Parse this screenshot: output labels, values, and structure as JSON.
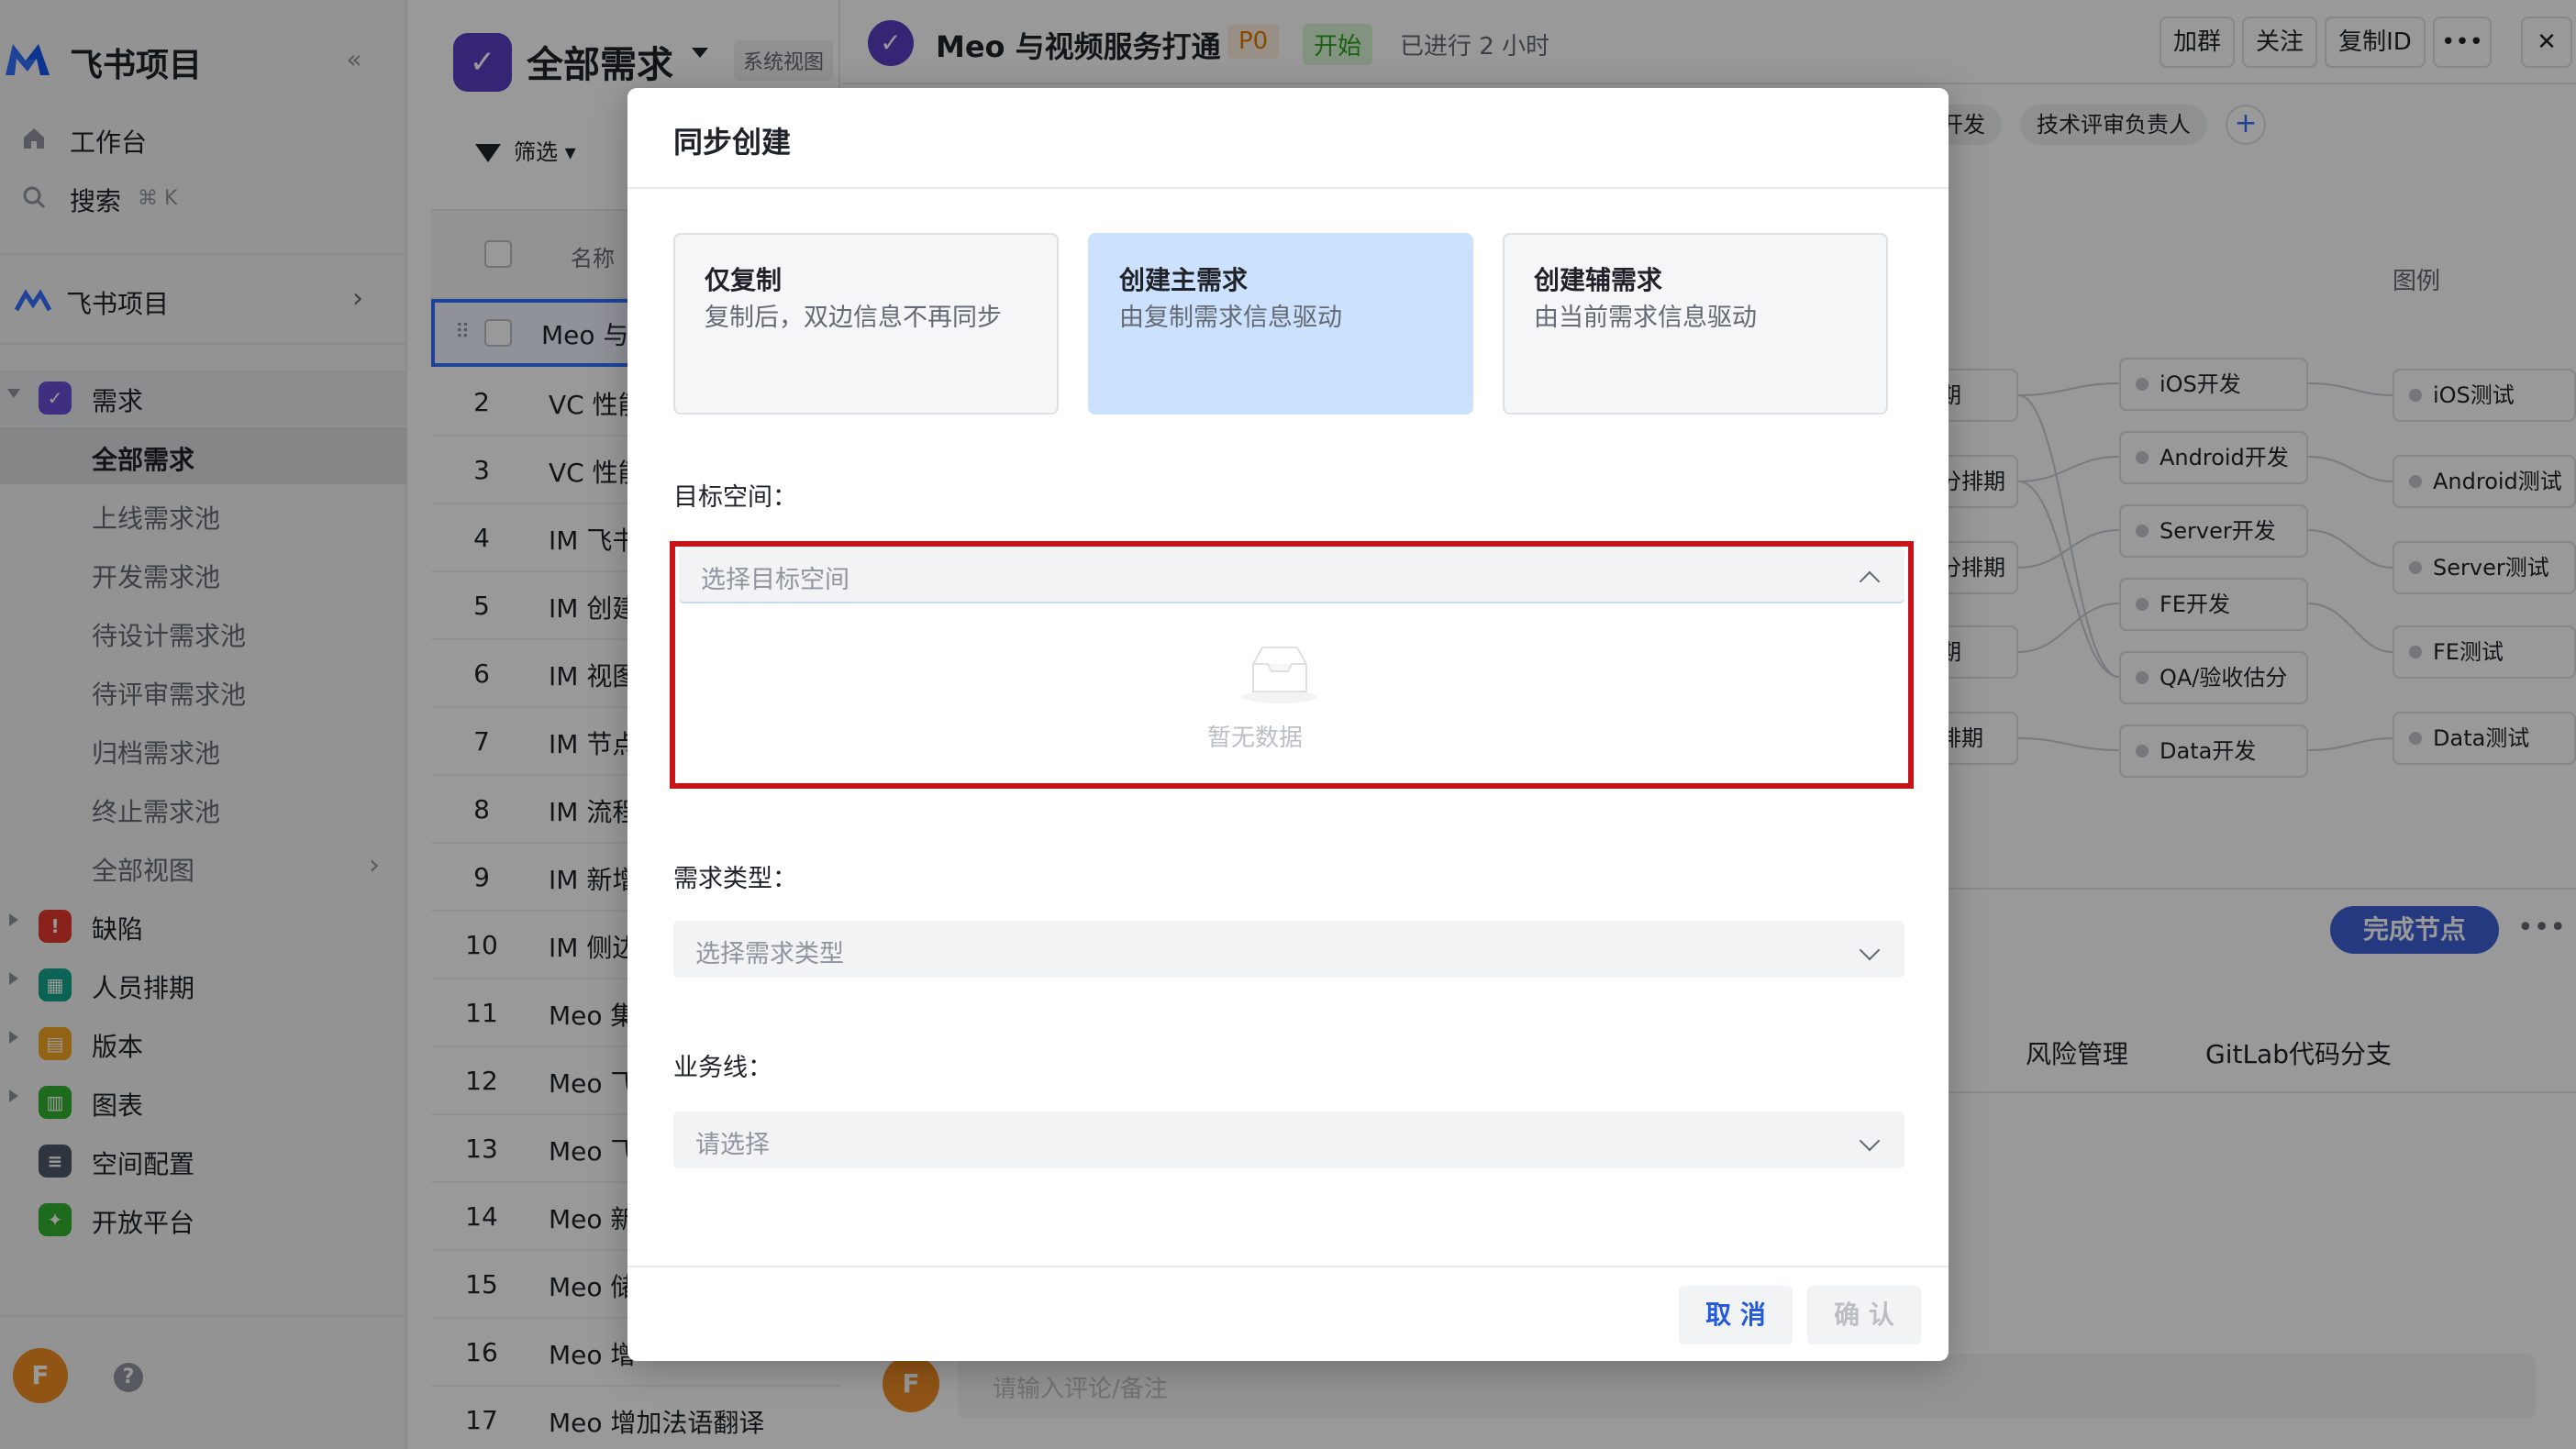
{
  "sidebar": {
    "brand": "飞书项目",
    "nav": [
      {
        "label": "工作台",
        "icon": "home-icon"
      },
      {
        "label": "搜索",
        "icon": "search-icon",
        "hint": "⌘ K"
      }
    ],
    "project": "飞书项目",
    "groups": [
      {
        "label": "需求",
        "icon": "requirement-icon",
        "color": "#6c4ed8"
      },
      {
        "label": "缺陷",
        "icon": "bug-icon",
        "color": "#e3392c"
      },
      {
        "label": "人员排期",
        "icon": "schedule-icon",
        "color": "#14a38b"
      },
      {
        "label": "版本",
        "icon": "version-icon",
        "color": "#f5a623"
      },
      {
        "label": "图表",
        "icon": "chart-icon",
        "color": "#34b233"
      },
      {
        "label": "空间配置",
        "icon": "settings-icon",
        "color": "#4e5969"
      },
      {
        "label": "开放平台",
        "icon": "open-platform-icon",
        "color": "#34b233"
      }
    ],
    "sub_items": [
      "全部需求",
      "上线需求池",
      "开发需求池",
      "待设计需求池",
      "待评审需求池",
      "归档需求池",
      "终止需求池",
      "全部视图"
    ],
    "user_initial": "F"
  },
  "list": {
    "title": "全部需求",
    "view_badge": "系统视图",
    "filter_label": "筛选",
    "name_column": "名称",
    "rows": [
      {
        "num": "",
        "title": "Meo 与"
      },
      {
        "num": "2",
        "title": "VC 性能"
      },
      {
        "num": "3",
        "title": "VC 性能"
      },
      {
        "num": "4",
        "title": "IM 飞书"
      },
      {
        "num": "5",
        "title": "IM 创建"
      },
      {
        "num": "6",
        "title": "IM 视图"
      },
      {
        "num": "7",
        "title": "IM 节点"
      },
      {
        "num": "8",
        "title": "IM 流程"
      },
      {
        "num": "9",
        "title": "IM 新增"
      },
      {
        "num": "10",
        "title": "IM 侧边"
      },
      {
        "num": "11",
        "title": "Meo 集"
      },
      {
        "num": "12",
        "title": "Meo 飞"
      },
      {
        "num": "13",
        "title": "Meo 飞"
      },
      {
        "num": "14",
        "title": "Meo 新"
      },
      {
        "num": "15",
        "title": "Meo 储"
      },
      {
        "num": "16",
        "title": "Meo 增"
      },
      {
        "num": "17",
        "title": "Meo 增加法语翻译"
      }
    ]
  },
  "detail": {
    "title": "Meo 与视频服务打通",
    "priority": "P0",
    "status": "开始",
    "elapsed": "已进行 2 小时",
    "actions": [
      "加群",
      "关注",
      "复制ID",
      "•••"
    ],
    "close": "✕",
    "role_pills": [
      "开发",
      "技术评审负责人"
    ],
    "add_pill": "+",
    "legend": "图例",
    "left_nodes": [
      "期",
      "分排期",
      "分排期",
      "期",
      "排期"
    ],
    "dev_nodes": [
      "iOS开发",
      "Android开发",
      "Server开发",
      "FE开发",
      "QA/验收估分",
      "Data开发"
    ],
    "test_nodes": [
      "iOS测试",
      "Android测试",
      "Server测试",
      "FE测试",
      "Data测试"
    ],
    "complete_button": "完成节点",
    "more": "•••",
    "tabs": [
      "风险管理",
      "GitLab代码分支"
    ],
    "comment_placeholder": "请输入评论/备注",
    "user_initial": "F"
  },
  "modal": {
    "title": "同步创建",
    "options": [
      {
        "title": "仅复制",
        "desc": "复制后，双边信息不再同步",
        "selected": false
      },
      {
        "title": "创建主需求",
        "desc": "由复制需求信息驱动",
        "selected": true
      },
      {
        "title": "创建辅需求",
        "desc": "由当前需求信息驱动",
        "selected": false
      }
    ],
    "target_space": {
      "label": "目标空间：",
      "placeholder": "选择目标空间",
      "empty_text": "暂无数据"
    },
    "req_type": {
      "label": "需求类型：",
      "placeholder": "选择需求类型"
    },
    "business_line": {
      "label": "业务线：",
      "placeholder": "请选择"
    },
    "cancel": "取 消",
    "confirm": "确 认"
  }
}
